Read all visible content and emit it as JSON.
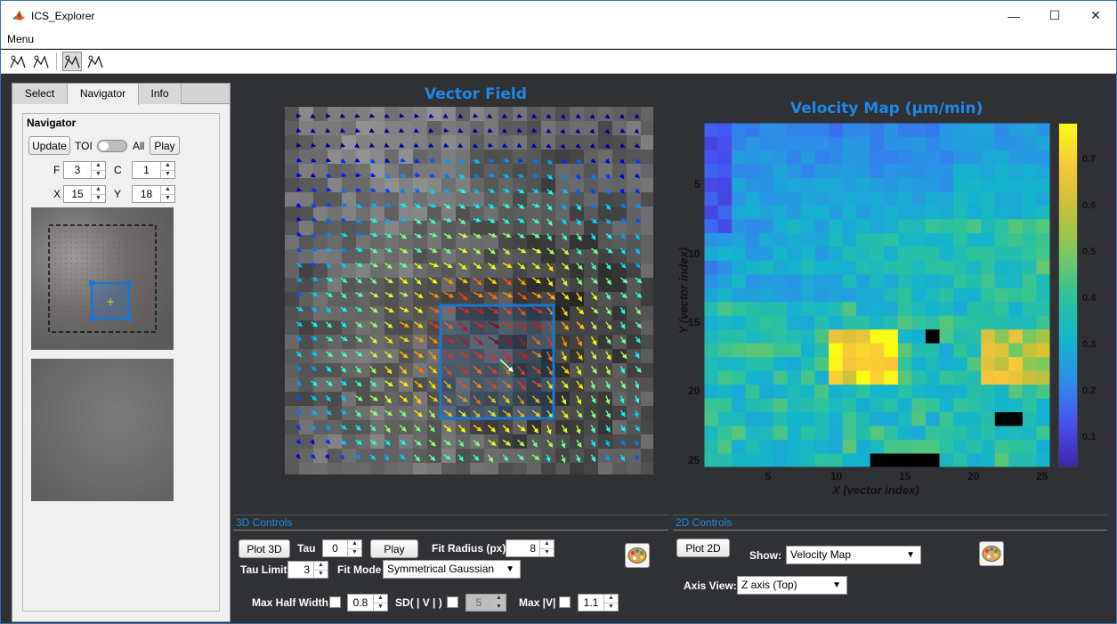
{
  "app": {
    "title": "ICS_Explorer"
  },
  "window_controls": {
    "minimize": "—",
    "maximize": "☐",
    "close": "✕"
  },
  "menu": {
    "label": "Menu"
  },
  "toolbar": {
    "icons": [
      "plot-icon",
      "plot-icon",
      "plot-toggled-icon",
      "plot-icon"
    ]
  },
  "left": {
    "tabs": [
      "Select",
      "Navigator",
      "Info"
    ],
    "active_tab": "Navigator",
    "navigator": {
      "title": "Navigator",
      "update": "Update",
      "toi": "TOI",
      "all": "All",
      "play": "Play",
      "f_label": "F",
      "f_value": "3",
      "c_label": "C",
      "c_value": "1",
      "x_label": "X",
      "x_value": "15",
      "y_label": "Y",
      "y_value": "18"
    }
  },
  "vector_field": {
    "title": "Vector Field"
  },
  "velocity_map": {
    "title": "Velocity  Map  (µm/min)",
    "xlabel": "X (vector index)",
    "ylabel": "Y (vector index)",
    "xticks": [
      "5",
      "10",
      "15",
      "20",
      "25"
    ],
    "yticks": [
      "5",
      "10",
      "15",
      "20",
      "25"
    ],
    "cticks": [
      "0.7",
      "0.6",
      "0.5",
      "0.4",
      "0.3",
      "0.2",
      "0.1"
    ]
  },
  "controls3d": {
    "header": "3D Controls",
    "plot": "Plot 3D",
    "tau_label": "Tau",
    "tau": "0",
    "play": "Play",
    "fit_radius_label": "Fit Radius (px)",
    "fit_radius": "8",
    "tau_limit_label": "Tau Limit",
    "tau_limit": "3",
    "fit_mode_label": "Fit Mode",
    "fit_mode": "Symmetrical Gaussian",
    "max_half_width_label": "Max Half Width",
    "max_half_width": "0.8",
    "sd_label": "SD( | V | )",
    "sd": "5",
    "maxv_label": "Max |V|",
    "maxv": "1.1"
  },
  "controls2d": {
    "header": "2D Controls",
    "plot": "Plot 2D",
    "show_label": "Show:",
    "show": "Velocity Map",
    "axis_view_label": "Axis View:",
    "axis_view": "Z axis (Top)"
  },
  "colors": {
    "accent": "#1e88e5",
    "bg": "#2f3135",
    "roi": "#1976d2"
  }
}
